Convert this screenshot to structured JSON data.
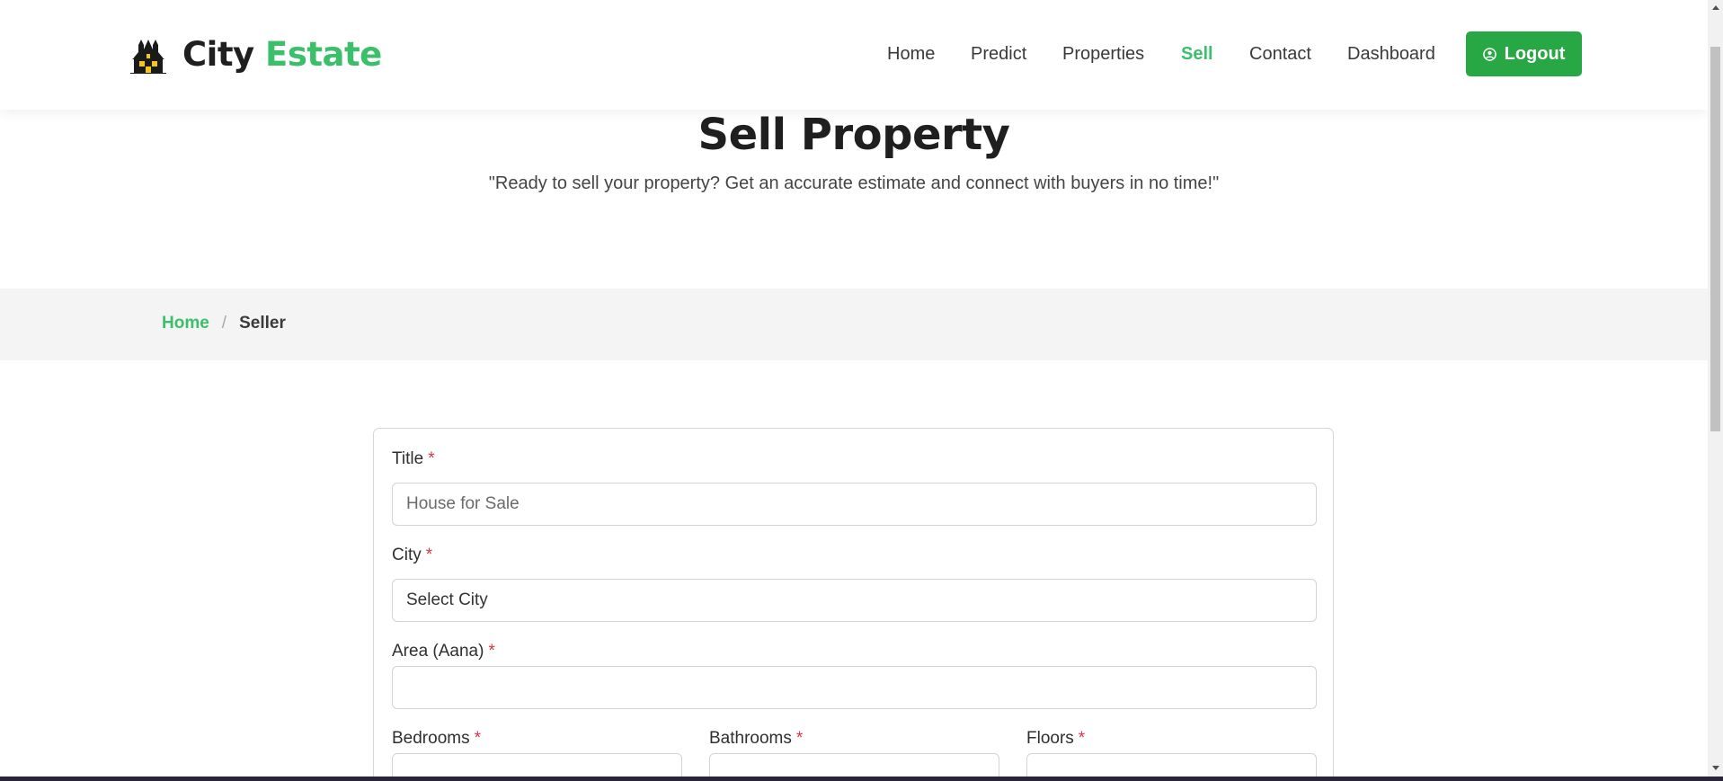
{
  "brand": {
    "name_part1": "City",
    "name_part2": "Estate",
    "logo_icon": "haunted-house-icon"
  },
  "nav": {
    "items": [
      {
        "label": "Home",
        "active": false
      },
      {
        "label": "Predict",
        "active": false
      },
      {
        "label": "Properties",
        "active": false
      },
      {
        "label": "Sell",
        "active": true
      },
      {
        "label": "Contact",
        "active": false
      },
      {
        "label": "Dashboard",
        "active": false
      }
    ],
    "logout_label": "Logout",
    "logout_icon": "user-circle-icon"
  },
  "hero": {
    "title": "Sell Property",
    "subtitle": "\"Ready to sell your property? Get an accurate estimate and connect with buyers in no time!\""
  },
  "breadcrumb": {
    "home": "Home",
    "separator": "/",
    "current": "Seller"
  },
  "form": {
    "required_marker": "*",
    "title": {
      "label": "Title",
      "placeholder": "House for Sale",
      "value": ""
    },
    "city": {
      "label": "City",
      "selected": "Select City"
    },
    "area": {
      "label": "Area (Aana)",
      "value": ""
    },
    "bedrooms": {
      "label": "Bedrooms",
      "value": ""
    },
    "bathrooms": {
      "label": "Bathrooms",
      "value": ""
    },
    "floors": {
      "label": "Floors",
      "value": ""
    }
  },
  "colors": {
    "accent_green": "#3bbf6b",
    "button_green": "#28a745",
    "required_red": "#dc3545",
    "breadcrumb_band": "#f4f4f4"
  }
}
